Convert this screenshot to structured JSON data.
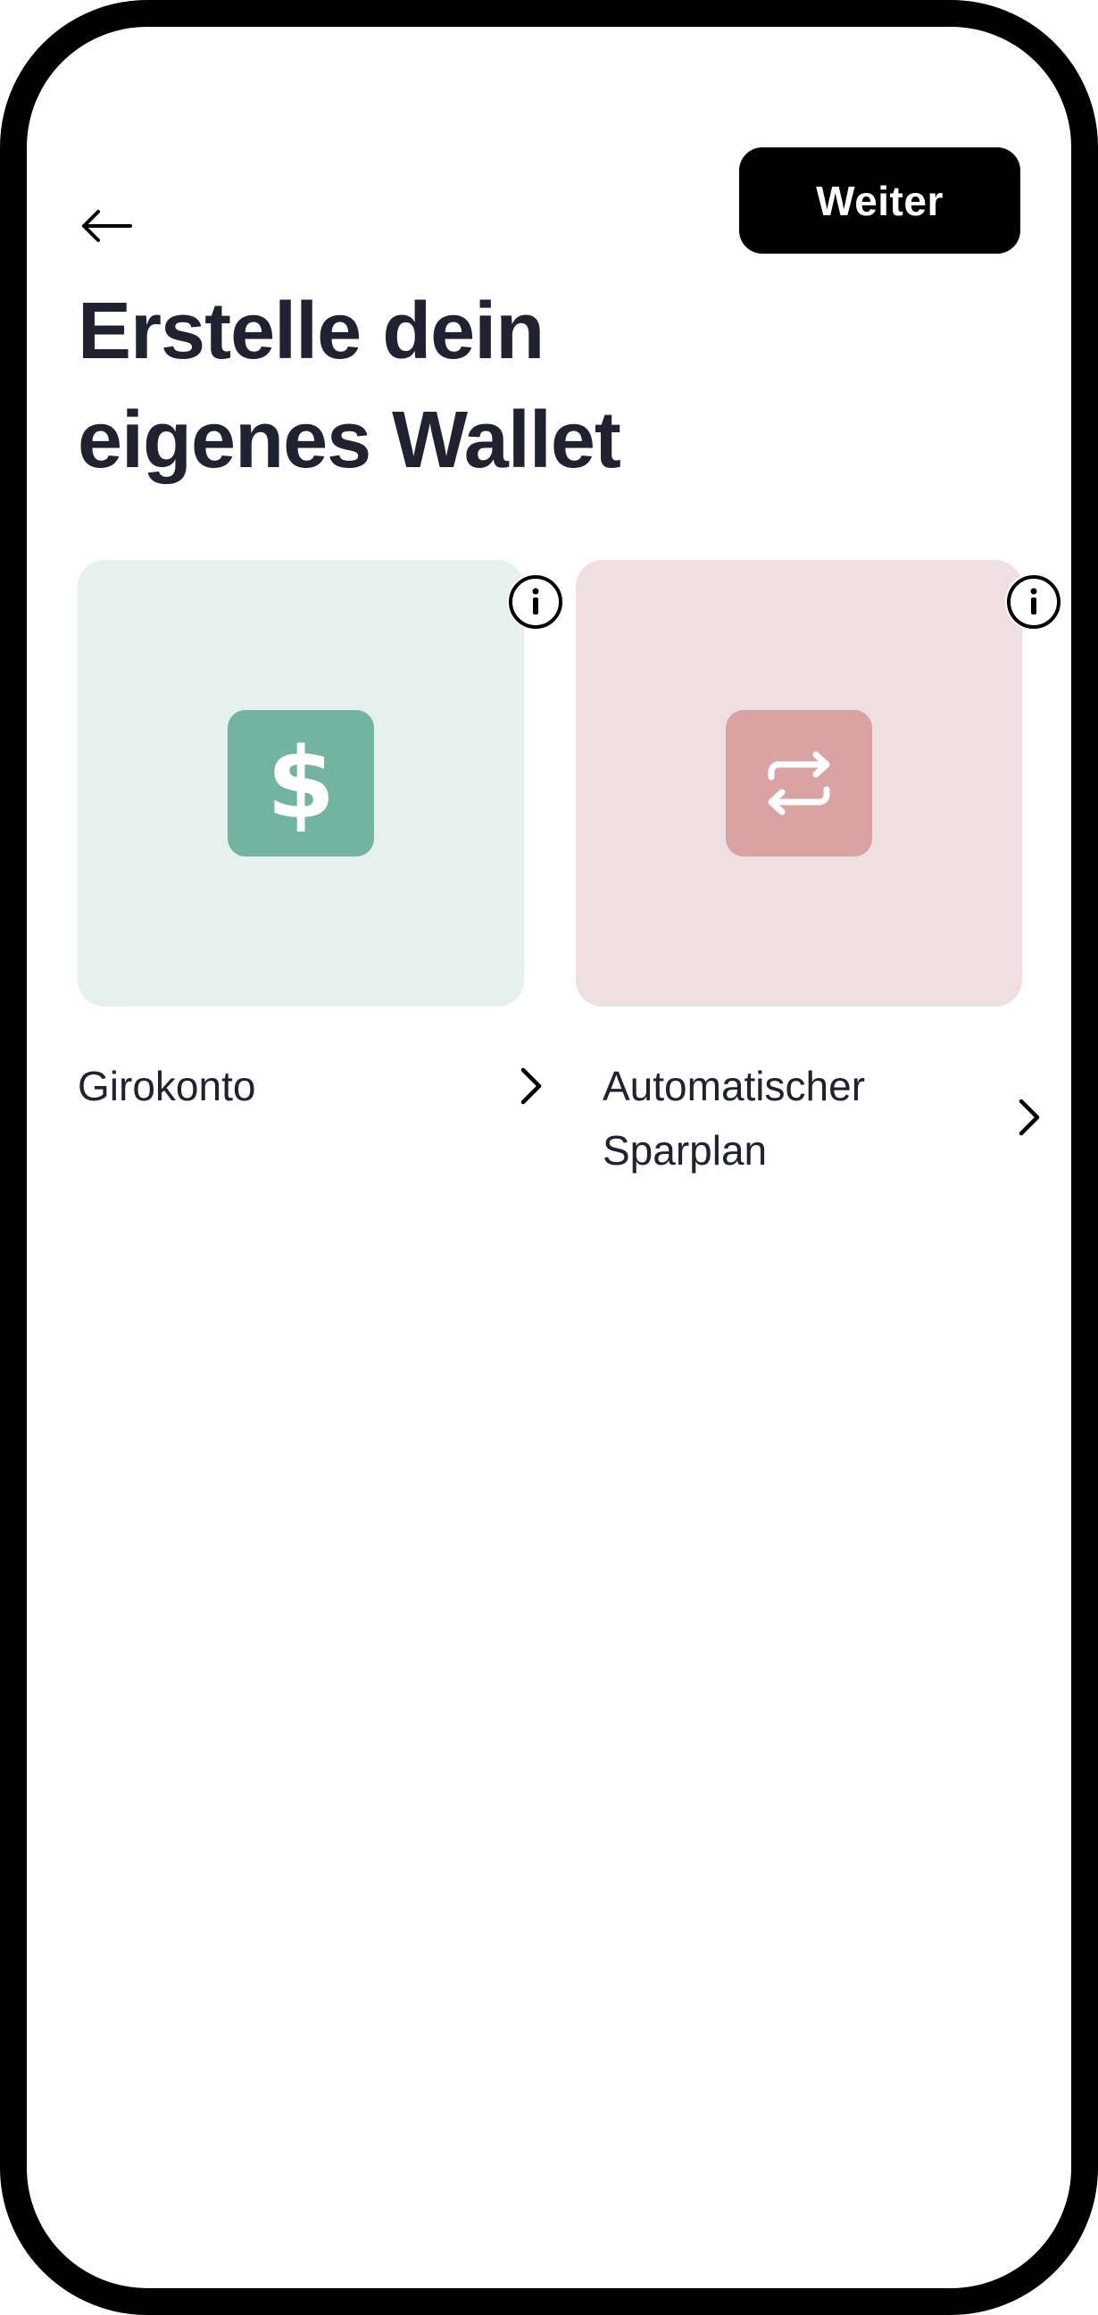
{
  "header": {
    "back_icon": "arrow-left-icon",
    "next_label": "Weiter"
  },
  "page": {
    "title_line1": "Erstelle dein",
    "title_line2": "eigenes Wallet"
  },
  "options": [
    {
      "label": "Girokonto",
      "icon": "dollar-icon",
      "card_color": "#e6f0ed",
      "tile_color": "#72b3a1",
      "info_icon": "info-icon",
      "chevron_icon": "chevron-right-icon"
    },
    {
      "label_line1": "Automatischer",
      "label_line2": "Sparplan",
      "icon": "repeat-icon",
      "card_color": "#f0dfe0",
      "tile_color": "#d9a2a3",
      "info_icon": "info-icon",
      "chevron_icon": "chevron-right-icon"
    }
  ],
  "colors": {
    "frame": "#000000",
    "text": "#20232f",
    "primary_button": "#000000",
    "primary_button_text": "#ffffff"
  }
}
